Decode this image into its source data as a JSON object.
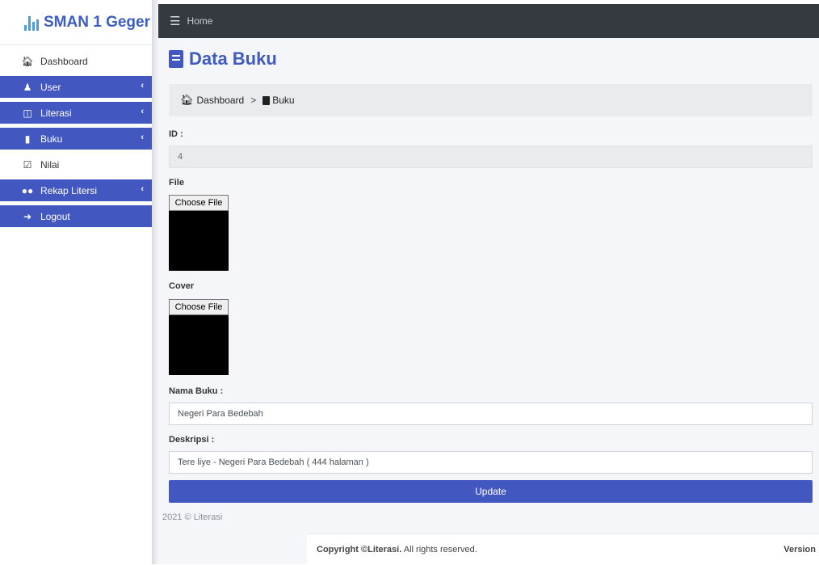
{
  "brand": {
    "title": "SMAN 1 Geger"
  },
  "sidebar": {
    "items": [
      {
        "label": "Dashboard",
        "icon": "home-icon"
      },
      {
        "label": "User",
        "icon": "users-cog-icon"
      },
      {
        "label": "Literasi",
        "icon": "book-open-icon"
      },
      {
        "label": "Buku",
        "icon": "book-icon"
      },
      {
        "label": "Nilai",
        "icon": "clipboard-check-icon"
      },
      {
        "label": "Rekap Litersi",
        "icon": "users-icon"
      },
      {
        "label": "Logout",
        "icon": "sign-out-icon"
      }
    ]
  },
  "topbar": {
    "home_label": "Home"
  },
  "page": {
    "title": "Data Buku"
  },
  "breadcrumb": {
    "dashboard": "Dashboard",
    "separator": ">",
    "current": "Buku"
  },
  "form": {
    "id_label": "ID :",
    "id_value": "4",
    "file_label": "File",
    "file_button": "Choose File",
    "cover_label": "Cover",
    "cover_button": "Choose File",
    "nama_label": "Nama Buku :",
    "nama_value": "Negeri Para Bedebah",
    "deskripsi_label": "Deskripsi :",
    "deskripsi_value": "Tere liye - Negeri Para Bedebah ( 444 halaman )",
    "update_label": "Update"
  },
  "footer": {
    "small": "2021 © Literasi",
    "copyright_bold": "Copyright ©Literasi.",
    "copyright_rest": " All rights reserved.",
    "version": "Version"
  },
  "colors": {
    "primary": "#4257c0",
    "topbar": "#343a40",
    "content_bg": "#f4f6f9"
  }
}
